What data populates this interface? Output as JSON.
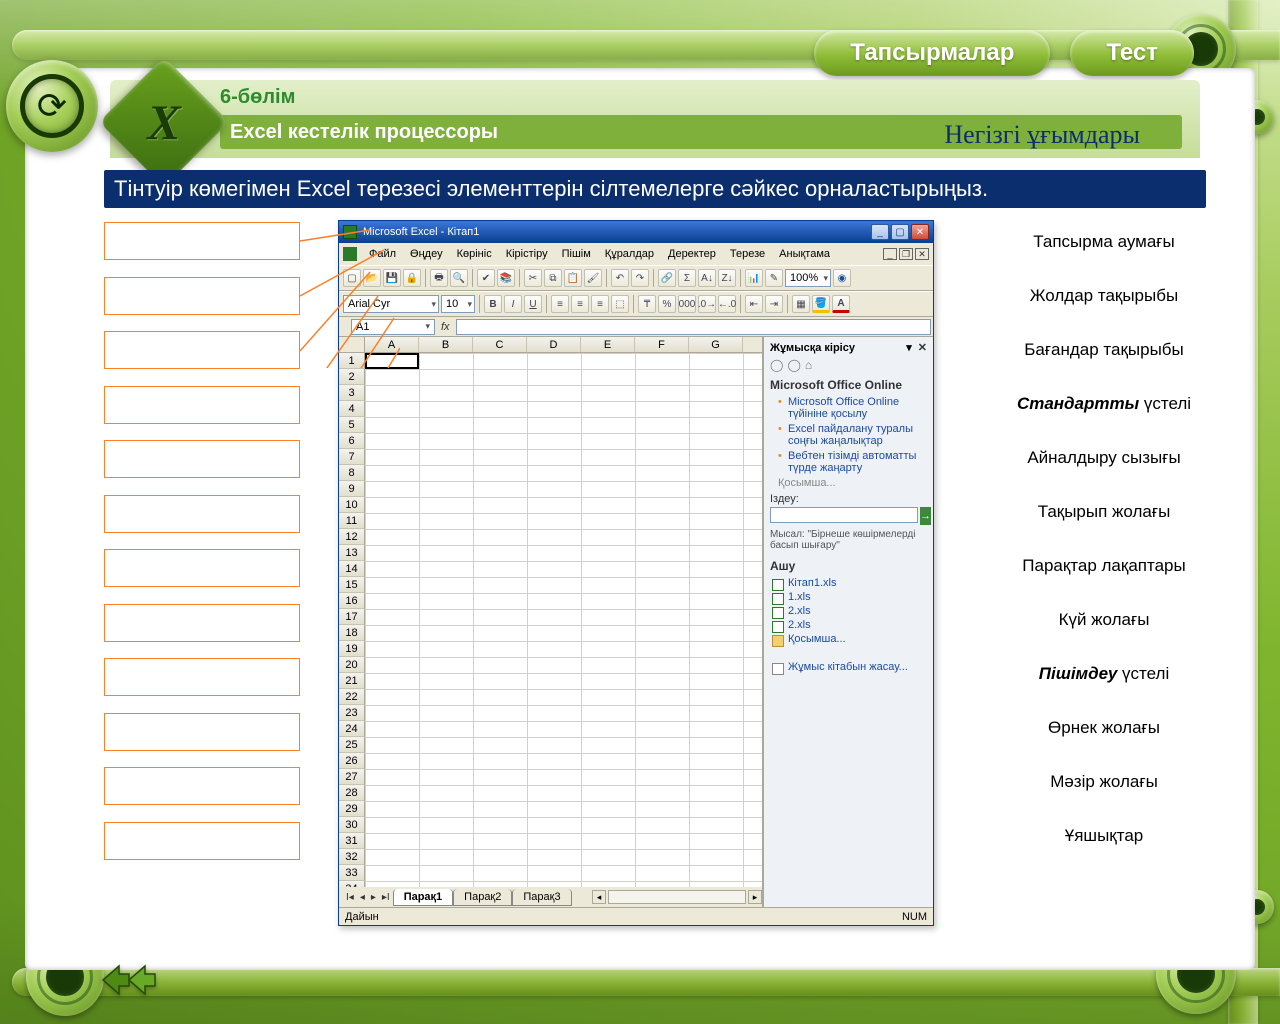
{
  "top_tabs": {
    "tasks": "Тапсырмалар",
    "test": "Тест"
  },
  "header": {
    "chapter": "6-бөлім",
    "subtitle": "Excel кестелік процессоры",
    "concept": "Негізгі ұғымдары"
  },
  "instruction": "Тінтуір көмегімен Excel  терезесі элементтерін сілтемелерге сәйкес орналастырыңыз.",
  "right_labels": [
    "Тапсырма аумағы",
    "Жолдар тақырыбы",
    "Бағандар тақырыбы",
    "<em>Стандартты</em> үстелі",
    "Айналдыру сызығы",
    "Тақырып жолағы",
    "Парақтар лақаптары",
    "Күй жолағы",
    "<em>Пішімдеу</em> үстелі",
    "Өрнек жолағы",
    "Мәзір жолағы",
    "Ұяшықтар"
  ],
  "excel": {
    "title": "Microsoft Excel - Кітап1",
    "menu": [
      "Файл",
      "Өңдеу",
      "Көрініс",
      "Кірістіру",
      "Пішім",
      "Құралдар",
      "Деректер",
      "Терезе",
      "Анықтама"
    ],
    "font_name": "Arial Cyr",
    "font_size": "10",
    "zoom": "100%",
    "name_box": "A1",
    "fx_label": "fx",
    "columns": [
      "A",
      "B",
      "C",
      "D",
      "E",
      "F",
      "G"
    ],
    "row_count": 34,
    "sheet_tabs": [
      "Парақ1",
      "Парақ2",
      "Парақ3"
    ],
    "status_ready": "Дайын",
    "status_num": "NUM",
    "task_pane": {
      "title": "Жұмысқа кірісу",
      "section_online": "Microsoft Office Online",
      "links": [
        "Microsoft Office Online түйініне қосылу",
        "Excel пайдалану туралы соңғы жаңалықтар",
        "Вебтен тізімді автоматты түрде жаңарту"
      ],
      "more": "Қосымша...",
      "search_label": "Іздеу:",
      "example": "Мысал: \"Бірнеше көшірмелерді басып шығару\"",
      "open_heading": "Ашу",
      "files": [
        "Кітап1.xls",
        "1.xls",
        "2.xls",
        "2.xls"
      ],
      "folder_more": "Қосымша...",
      "new_workbook": "Жұмыс кітабын жасау..."
    }
  }
}
